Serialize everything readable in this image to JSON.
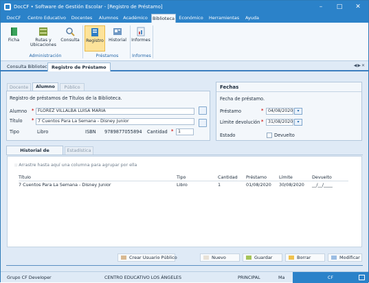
{
  "window": {
    "title": "DocCF • Software de Gestión Escolar  - [Registro de Préstamo]"
  },
  "menu": [
    "DocCF",
    "Centro Educativo",
    "Docentes",
    "Alumnos",
    "Académico",
    "Biblioteca",
    "Económico",
    "Herramientas",
    "Ayuda"
  ],
  "ribbon": {
    "ficha": "Ficha",
    "rutas": "Rutas y Ubicaciones",
    "consulta": "Consulta",
    "registro": "Registro",
    "historial": "Historial",
    "informes": "Informes",
    "group_admin": "Administración",
    "group_prestamos": "Préstamos",
    "group_informes": "Informes"
  },
  "doc_tabs": [
    "Consulta Biblioteca",
    "Registro de Préstamo"
  ],
  "left_panel": {
    "tabs": [
      "Docente",
      "Alumno",
      "Público"
    ],
    "description": "Registro de préstamos de Títulos de la Biblioteca.",
    "alumno_label": "Alumno",
    "alumno_value": "FLOREZ VILLALBA LUISA MARIA",
    "titulo_label": "Título",
    "titulo_value": "7 Cuentos Para La Semana - Disney Junior",
    "tipo_label": "Tipo",
    "tipo_value": "Libro",
    "isbn_label": "ISBN",
    "isbn_value": "9789877055894",
    "cantidad_label": "Cantidad",
    "cantidad_value": "1"
  },
  "right_panel": {
    "title": "Fechas",
    "description": "Fecha de préstamo.",
    "prestamo_label": "Préstamo",
    "prestamo_value": "04/08/2020",
    "limite_label": "Límite devolución",
    "limite_value": "31/08/2020",
    "estado_label": "Estado",
    "devuelto_label": "Devuelto"
  },
  "history": {
    "tabs": [
      "Historial de Préstamos",
      "Estadística"
    ],
    "group_hint": ":: Arrastre hasta aquí una columna para agrupar por ella",
    "columns": [
      "Título",
      "Tipo",
      "Cantidad",
      "Préstamo",
      "Límite",
      "Devuelto"
    ],
    "rows": [
      [
        "7 Cuentos Para La Semana - Disney Junior",
        "Libro",
        "1",
        "01/08/2020",
        "30/08/2020",
        "__/__/____"
      ]
    ]
  },
  "buttons": {
    "crear": "Crear Usuario Público",
    "nuevo": "Nuevo",
    "guardar": "Guardar",
    "borrar": "Borrar",
    "modificar": "Modificar"
  },
  "status": {
    "group": "Grupo CF Developer",
    "center": "CENTRO EDUCATIVO LOS ÁNGELES",
    "principal": "PRINCIPAL",
    "ma": "Ma",
    "cf": "CF"
  },
  "colors": {
    "accent": "#2b82c9",
    "selected": "#fde39a",
    "required": "#d21f1f"
  }
}
